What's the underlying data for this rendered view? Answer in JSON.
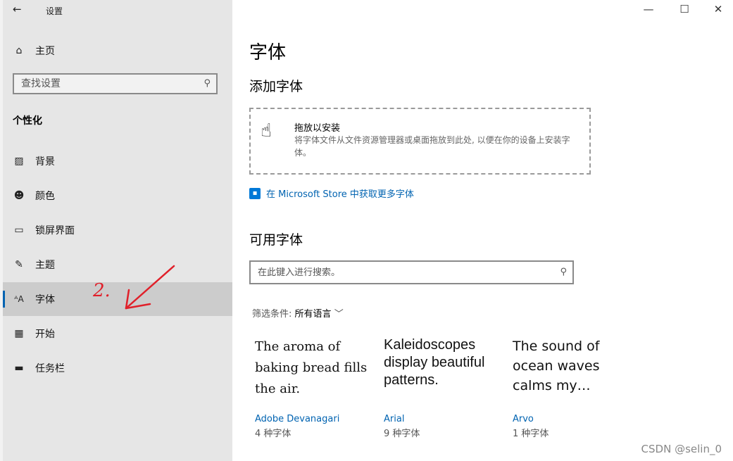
{
  "window": {
    "title": "设置",
    "back_icon": "back-arrow-icon"
  },
  "sidebar": {
    "home_label": "主页",
    "search_placeholder": "查找设置",
    "section_title": "个性化",
    "items": [
      {
        "label": "背景",
        "icon": "image-icon"
      },
      {
        "label": "颜色",
        "icon": "palette-icon"
      },
      {
        "label": "锁屏界面",
        "icon": "lock-screen-icon"
      },
      {
        "label": "主题",
        "icon": "theme-brush-icon"
      },
      {
        "label": "字体",
        "icon": "font-icon",
        "active": true
      },
      {
        "label": "开始",
        "icon": "start-icon"
      },
      {
        "label": "任务栏",
        "icon": "taskbar-icon"
      }
    ]
  },
  "annotation": {
    "text": "2.",
    "color": "#e0202a"
  },
  "main": {
    "title": "字体",
    "add_fonts_heading": "添加字体",
    "dropzone": {
      "title": "拖放以安装",
      "description": "将字体文件从文件资源管理器或桌面拖放到此处, 以便在你的设备上安装字体。"
    },
    "store_link": "在 Microsoft Store 中获取更多字体",
    "available_heading": "可用字体",
    "search_placeholder": "在此键入进行搜索。",
    "filter_label": "筛选条件:",
    "filter_value": "所有语言",
    "fonts": [
      {
        "preview": "The aroma of baking bread fills the air.",
        "name": "Adobe Devanagari",
        "count": "4 种字体"
      },
      {
        "preview": "Kaleidoscopes display beautiful patterns.",
        "name": "Arial",
        "count": "9 种字体"
      },
      {
        "preview": "The sound of ocean waves calms my…",
        "name": "Arvo",
        "count": "1 种字体"
      }
    ]
  },
  "watermark": "CSDN @selin_0",
  "colors": {
    "accent": "#0063b1",
    "sidebar_bg": "#e6e6e6",
    "active_bg": "#cccccc"
  }
}
